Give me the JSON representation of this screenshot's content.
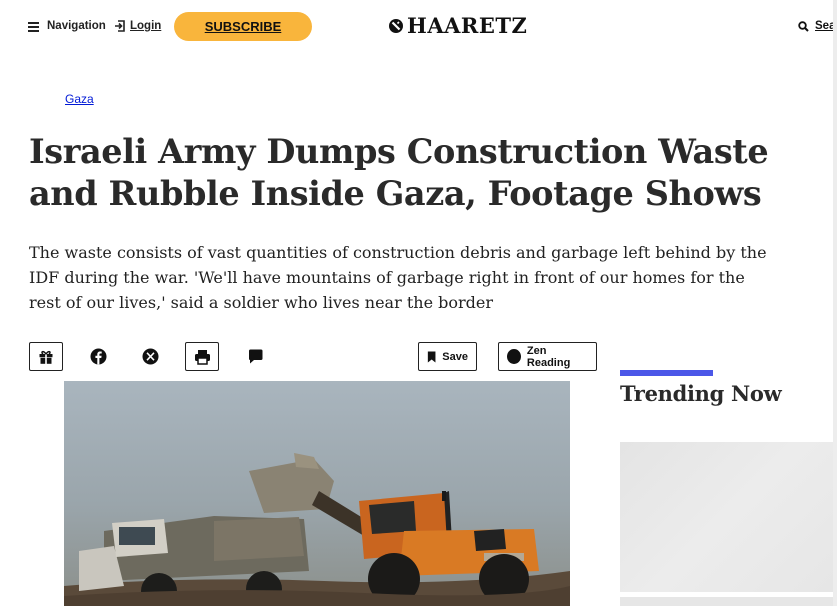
{
  "header": {
    "nav_label": "Navigation",
    "login_label": "Login",
    "subscribe_label": "SUBSCRIBE",
    "logo_text": "HAARETZ",
    "search_label": "Search"
  },
  "article": {
    "kicker": "Gaza",
    "headline": "Israeli Army Dumps Construction Waste and Rubble Inside Gaza, Footage Shows",
    "dek": "The waste consists of vast quantities of construction debris and garbage left behind by the IDF during the war. 'We'll have mountains of garbage right in front of our homes for the rest of our lives,' said a soldier who lives near the border"
  },
  "toolbar": {
    "items": [
      {
        "name": "gift-icon"
      },
      {
        "name": "facebook-icon"
      },
      {
        "name": "x-icon"
      },
      {
        "name": "print-icon"
      },
      {
        "name": "comment-icon"
      }
    ],
    "save_label": "Save",
    "zen_label": "Zen Reading"
  },
  "sidebar": {
    "trending_title": "Trending Now"
  },
  "colors": {
    "subscribe": "#f9b53c",
    "link": "#0019d6",
    "trending_accent": "#4c57e8"
  }
}
